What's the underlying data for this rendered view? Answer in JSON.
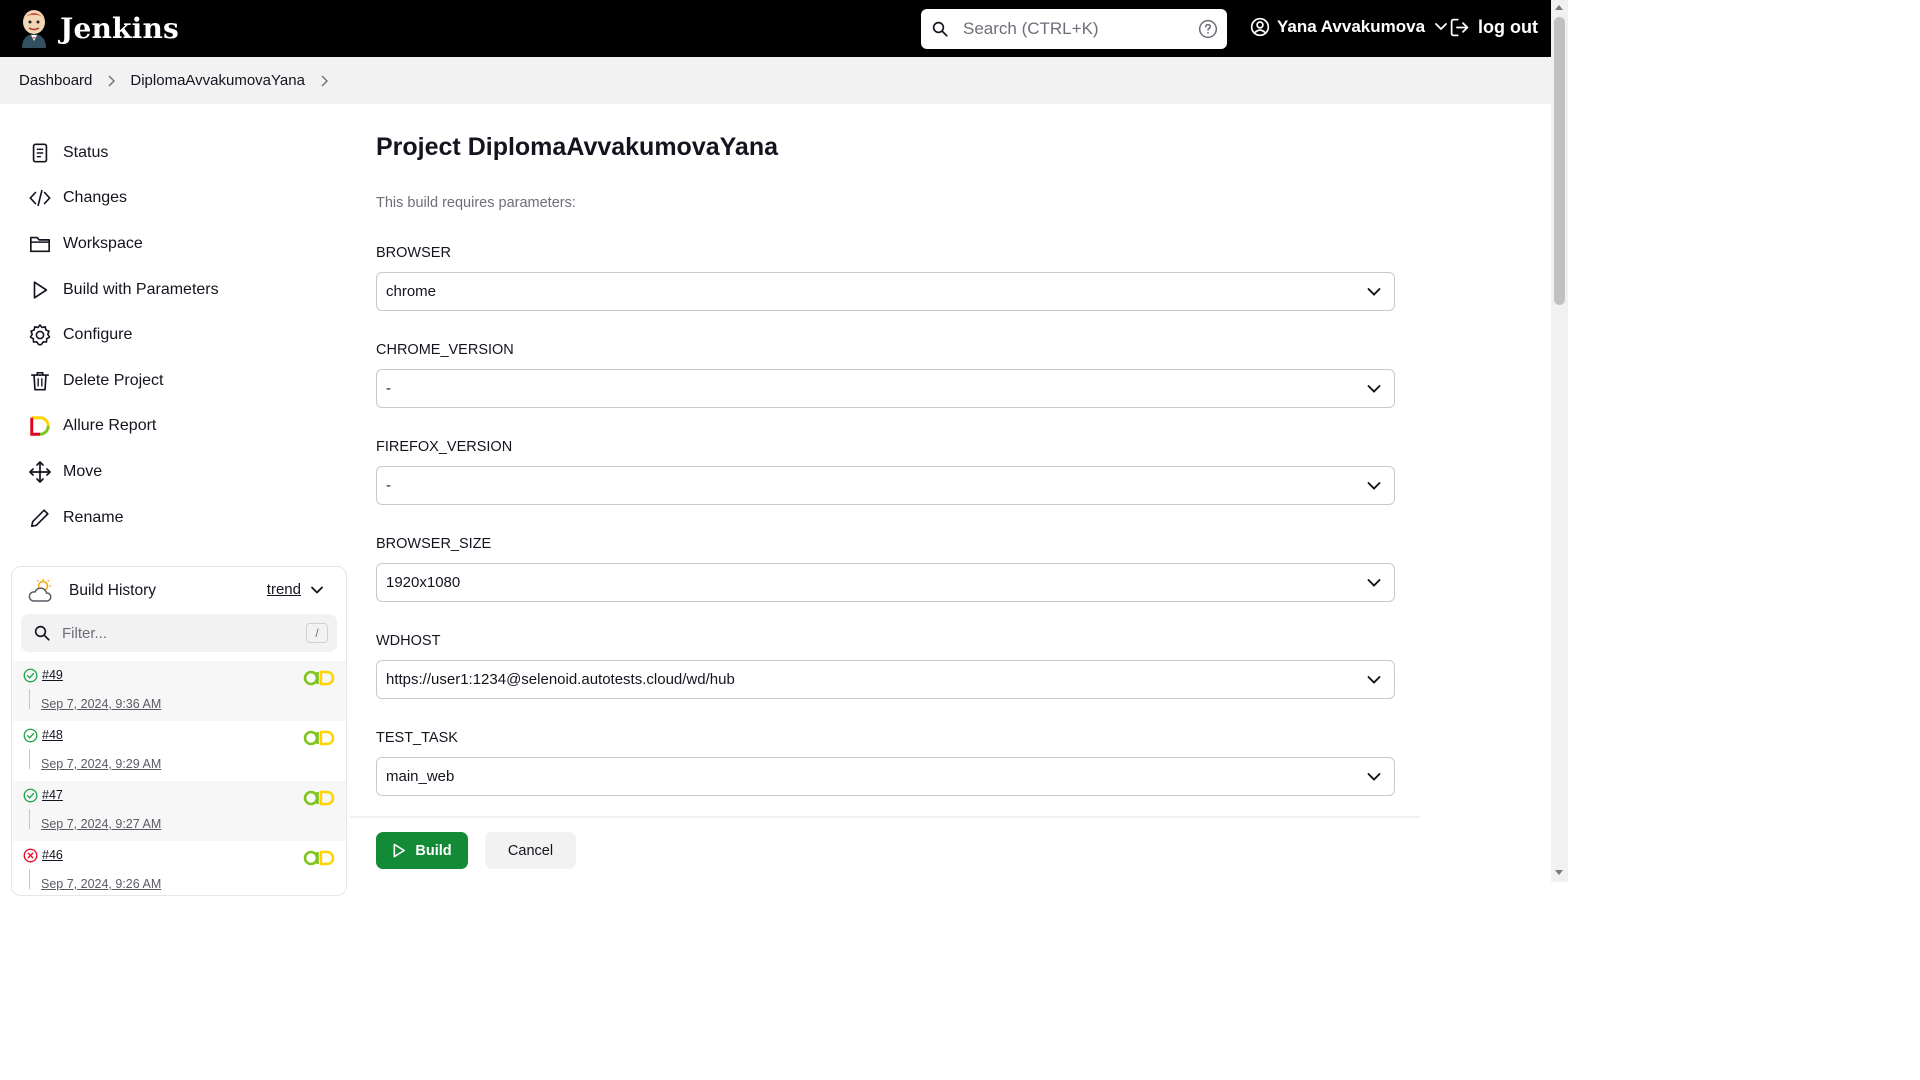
{
  "header": {
    "logo_text": "Jenkins",
    "search_placeholder": "Search (CTRL+K)",
    "user_name": "Yana Avvakumova",
    "logout_label": "log out"
  },
  "breadcrumb": [
    "Dashboard",
    "DiplomaAvvakumovaYana"
  ],
  "sidebar": {
    "items": [
      {
        "label": "Status",
        "icon": "document-icon"
      },
      {
        "label": "Changes",
        "icon": "code-icon"
      },
      {
        "label": "Workspace",
        "icon": "folder-icon"
      },
      {
        "label": "Build with Parameters",
        "icon": "play-icon"
      },
      {
        "label": "Configure",
        "icon": "gear-icon"
      },
      {
        "label": "Delete Project",
        "icon": "trash-icon"
      },
      {
        "label": "Allure Report",
        "icon": "allure-icon"
      },
      {
        "label": "Move",
        "icon": "move-icon"
      },
      {
        "label": "Rename",
        "icon": "pencil-icon"
      }
    ]
  },
  "build_history": {
    "title": "Build History",
    "trend_label": "trend",
    "filter_placeholder": "Filter...",
    "filter_shortcut": "/",
    "builds": [
      {
        "number": "#49",
        "date": "Sep 7, 2024, 9:36 AM",
        "status": "success"
      },
      {
        "number": "#48",
        "date": "Sep 7, 2024, 9:29 AM",
        "status": "success"
      },
      {
        "number": "#47",
        "date": "Sep 7, 2024, 9:27 AM",
        "status": "success"
      },
      {
        "number": "#46",
        "date": "Sep 7, 2024, 9:26 AM",
        "status": "failed"
      }
    ]
  },
  "main": {
    "title": "Project DiplomaAvvakumovaYana",
    "subtitle": "This build requires parameters:",
    "params": [
      {
        "name": "BROWSER",
        "value": "chrome"
      },
      {
        "name": "CHROME_VERSION",
        "value": "-"
      },
      {
        "name": "FIREFOX_VERSION",
        "value": "-"
      },
      {
        "name": "BROWSER_SIZE",
        "value": "1920x1080"
      },
      {
        "name": "WDHOST",
        "value": "https://user1:1234@selenoid.autotests.cloud/wd/hub"
      },
      {
        "name": "TEST_TASK",
        "value": "main_web"
      }
    ],
    "build_button": "Build",
    "cancel_button": "Cancel"
  },
  "colors": {
    "header_bg": "#000000",
    "build_button_bg": "#138a36",
    "success": "#1ea446",
    "failed": "#e6001f",
    "allure_green": "#7dc41b",
    "allure_yellow": "#ffd400"
  }
}
